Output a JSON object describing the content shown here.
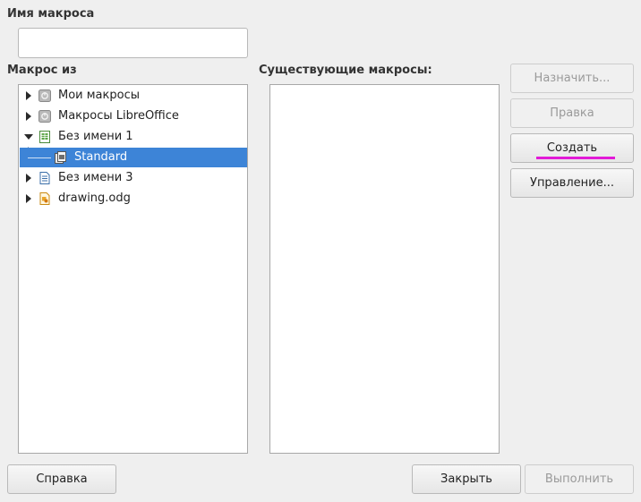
{
  "macro_name": {
    "label": "Имя макроса",
    "value": ""
  },
  "macro_from": {
    "label": "Макрос из",
    "tree": [
      {
        "label": "Мои макросы",
        "expander": "collapsed",
        "icon": "macro-library-icon",
        "selected": false
      },
      {
        "label": "Макросы LibreOffice",
        "expander": "collapsed",
        "icon": "macro-library-icon",
        "selected": false
      },
      {
        "label": "Без имени 1",
        "expander": "expanded",
        "icon": "spreadsheet-icon",
        "selected": false
      },
      {
        "label": "Standard",
        "expander": "none",
        "icon": "basic-library-icon",
        "selected": true
      },
      {
        "label": "Без имени 3",
        "expander": "collapsed",
        "icon": "text-document-icon",
        "selected": false
      },
      {
        "label": "drawing.odg",
        "expander": "collapsed",
        "icon": "drawing-icon",
        "selected": false
      }
    ]
  },
  "existing_macros": {
    "label": "Существующие макросы:",
    "items": []
  },
  "side_buttons": {
    "assign": "Назначить...",
    "edit": "Правка",
    "create": "Создать",
    "manage": "Управление..."
  },
  "bottom_buttons": {
    "help": "Справка",
    "close": "Закрыть",
    "run": "Выполнить"
  },
  "colors": {
    "selection": "#3d84d7",
    "create_underline": "#e21ad7"
  }
}
